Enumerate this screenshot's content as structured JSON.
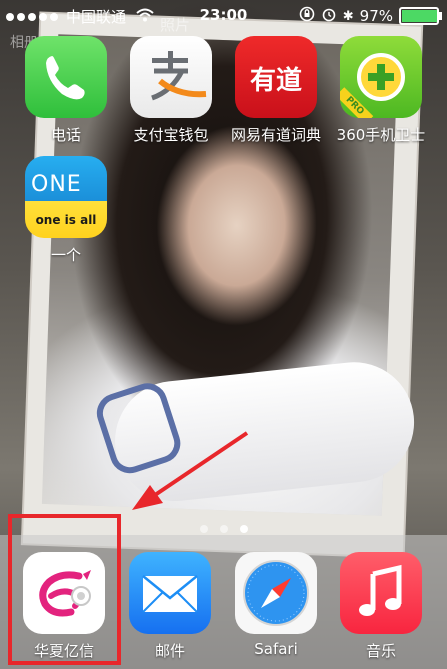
{
  "status_bar": {
    "carrier": "中国联通",
    "signal_dots": 5,
    "time": "23:00",
    "battery": "97%",
    "battery_level": 0.97
  },
  "wallpaper": {
    "behind_text": "照片",
    "corner_text": "相册"
  },
  "apps": [
    {
      "label": "电话",
      "icon": "phone-icon",
      "color": "#4cd964"
    },
    {
      "label": "支付宝钱包",
      "icon": "alipay-icon",
      "color": "#f2f2f2"
    },
    {
      "label": "网易有道词典",
      "icon": "youdao-icon",
      "color": "#e1161c",
      "glyph": "有道"
    },
    {
      "label": "360手机卫士",
      "icon": "360-security-icon",
      "color": "#6ecf2d",
      "badge": "PRO"
    },
    {
      "label": "一个",
      "icon": "one-icon",
      "color": "#1da0e8",
      "glyph_top": "ONE",
      "glyph_bottom": "one is all"
    }
  ],
  "page_indicator": {
    "pages": 3,
    "active": 3
  },
  "dock": [
    {
      "label": "华夏亿信",
      "icon": "huaxia-yixin-icon",
      "color": "#ffffff"
    },
    {
      "label": "邮件",
      "icon": "mail-icon",
      "color": "#1d8ef5"
    },
    {
      "label": "Safari",
      "icon": "safari-icon",
      "color": "#f7f7f7"
    },
    {
      "label": "音乐",
      "icon": "music-icon",
      "color": "#fb3b52"
    }
  ],
  "annotation": {
    "highlight_color": "#e8272b"
  }
}
